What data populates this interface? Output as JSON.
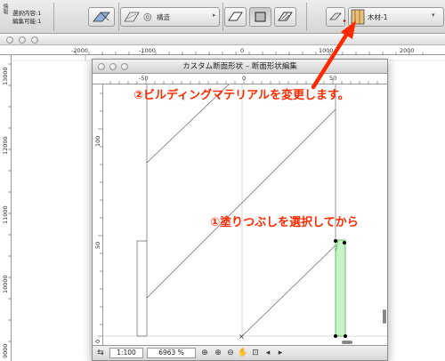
{
  "toolbar": {
    "info_line1": "選択内容:1",
    "info_line2": "編集可能:1",
    "layer_name": "構造",
    "material_name": "木材-1",
    "side_label": "情報"
  },
  "ruler": {
    "h_ticks": [
      "-2000",
      "-1000",
      "0",
      "1000",
      "2000"
    ],
    "v_ticks": [
      "13000",
      "12000",
      "11000",
      "10000",
      "9000"
    ]
  },
  "dialog": {
    "title": "カスタム断面形状 – 断面形状編集",
    "h_ticks": [
      "-50",
      "0",
      "50"
    ],
    "v_ticks": [
      "100",
      "50",
      "0"
    ],
    "scale": "1:100",
    "zoom": "6963 %"
  },
  "annotations": {
    "step2": "②ビルディングマテリアルを変更します。",
    "step1": "①塗りつぶしを選択してから"
  },
  "colors": {
    "annotation": "#ff2a00",
    "selected_fill": "#c9f2c4"
  }
}
